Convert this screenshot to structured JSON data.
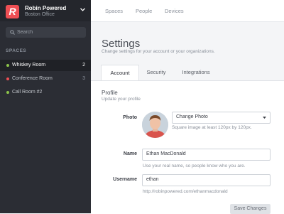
{
  "org": {
    "logo_letter": "R",
    "name": "Robin Powered",
    "location": "Boston Office"
  },
  "search": {
    "placeholder": "Search"
  },
  "spaces": {
    "section_label": "SPACES",
    "items": [
      {
        "label": "Whiskey Room",
        "count": "2",
        "dot_color": "#8bc34a",
        "active": true
      },
      {
        "label": "Conference Room",
        "count": "3",
        "dot_color": "#ef4f54",
        "active": false
      },
      {
        "label": "Call Room #2",
        "count": "",
        "dot_color": "#8bc34a",
        "active": false
      }
    ]
  },
  "topnav": {
    "items": [
      "Spaces",
      "People",
      "Devices"
    ]
  },
  "page": {
    "title": "Settings",
    "subtitle": "Change settings for your account or your organizations."
  },
  "tabs": [
    {
      "label": "Account",
      "active": true
    },
    {
      "label": "Security",
      "active": false
    },
    {
      "label": "Integrations",
      "active": false
    }
  ],
  "profile": {
    "title": "Profile",
    "subtitle": "Update your profile",
    "photo": {
      "label": "Photo",
      "select_value": "Change Photo",
      "hint": "Square image at least 120px by 120px."
    },
    "name": {
      "label": "Name",
      "value": "Ethan MacDonald",
      "hint": "Use your real name, so people know who you are."
    },
    "username": {
      "label": "Username",
      "value": "ethan",
      "hint": "http://robinpowered.com/ethanmacdonald"
    },
    "save_label": "Save Changes"
  },
  "colors": {
    "accent": "#ef4f54",
    "sidebar_bg": "#2b2d34",
    "online": "#8bc34a"
  }
}
